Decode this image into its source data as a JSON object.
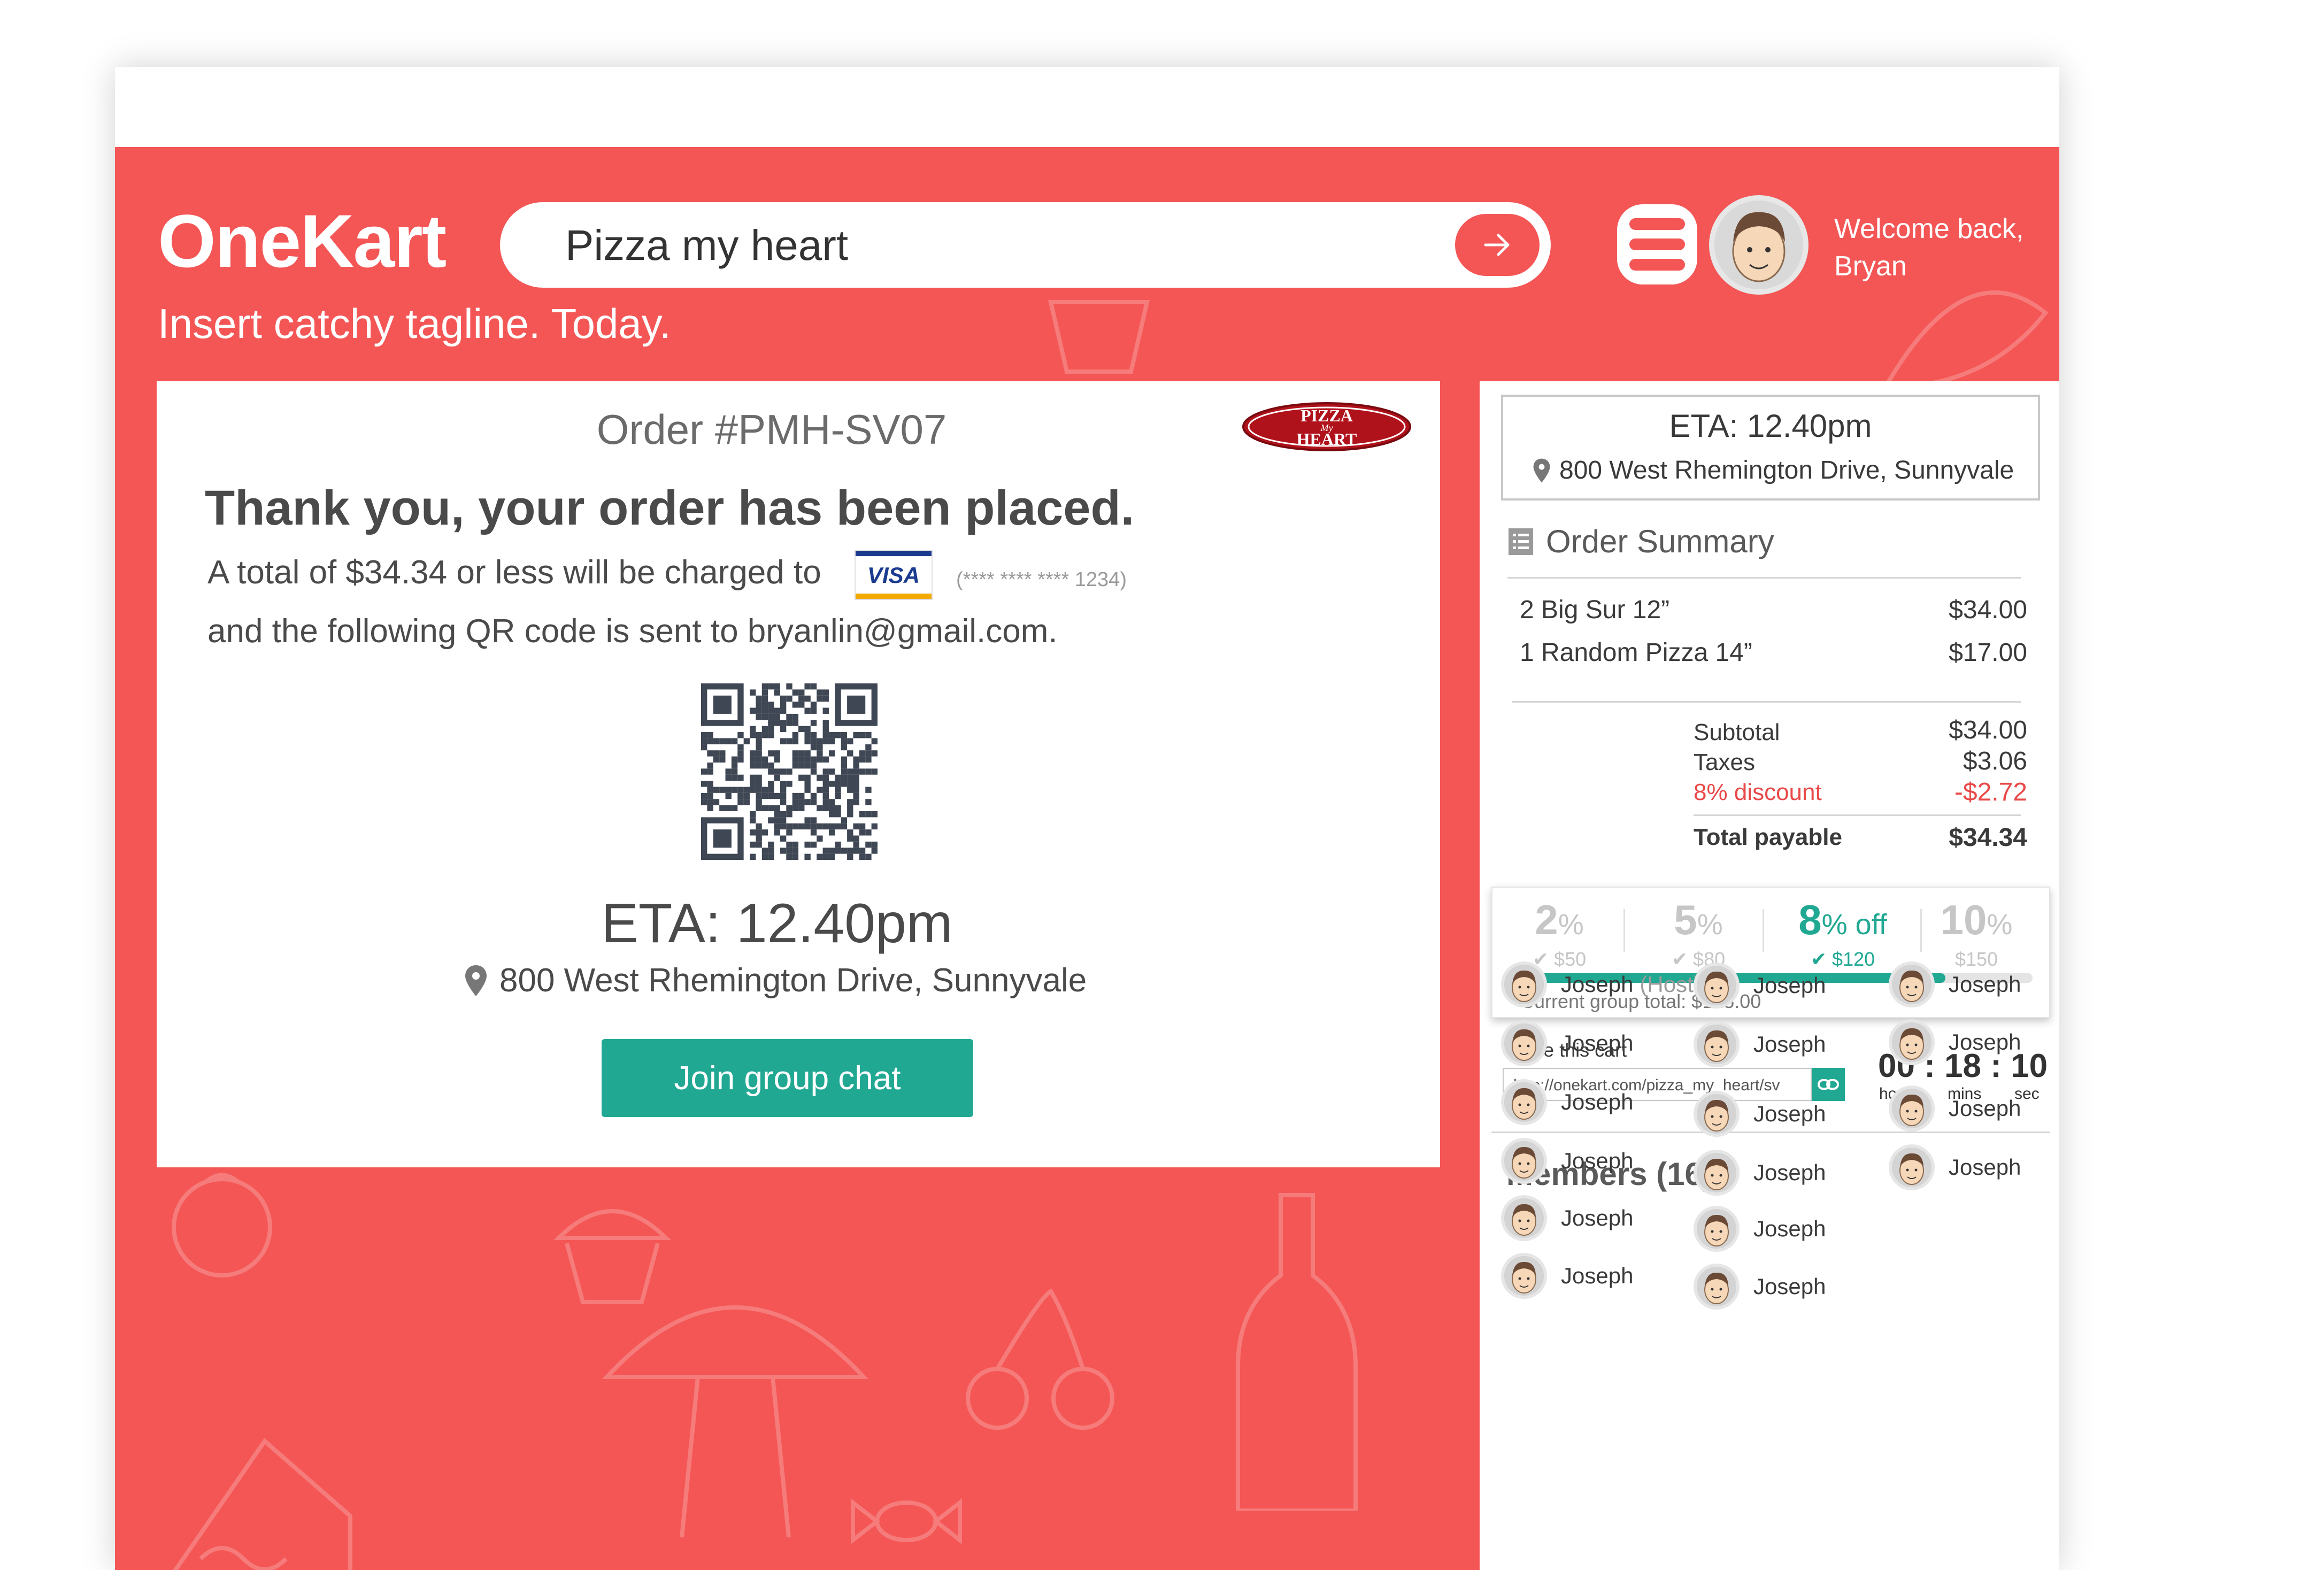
{
  "header": {
    "brand": "OneKart",
    "tagline": "Insert catchy tagline. Today.",
    "search_value": "Pizza my heart",
    "welcome_line1": "Welcome back,",
    "welcome_line2": "Bryan"
  },
  "order": {
    "number": "Order #PMH-SV07",
    "restaurant_logo_line1": "PIZZA",
    "restaurant_logo_line2": "My",
    "restaurant_logo_line3": "HEART",
    "thank_you": "Thank you, your order has been placed.",
    "charged_text": "A total of $34.34 or less will be charged to",
    "card_brand": "VISA",
    "card_mask": "(**** **** **** 1234)",
    "qr_text": "and the following QR code is sent to bryanlin@gmail.com.",
    "eta": "ETA: 12.40pm",
    "address": "800 West Rhemington Drive, Sunnyvale",
    "join_button": "Join group chat"
  },
  "summary": {
    "eta": "ETA: 12.40pm",
    "address": "800 West Rhemington Drive, Sunnyvale",
    "title": "Order Summary",
    "items": [
      {
        "name": "2 Big Sur 12”",
        "price": "$34.00"
      },
      {
        "name": "1 Random Pizza 14”",
        "price": "$17.00"
      }
    ],
    "subtotal_label": "Subtotal",
    "subtotal": "$34.00",
    "taxes_label": "Taxes",
    "taxes": "$3.06",
    "discount_label": "8% discount",
    "discount": "-$2.72",
    "total_label": "Total payable",
    "total": "$34.34"
  },
  "tiers": {
    "items": [
      {
        "pct": "2",
        "unit": "%",
        "amount": "$50"
      },
      {
        "pct": "5",
        "unit": "%",
        "amount": "$80"
      },
      {
        "pct": "8",
        "unit": "% off",
        "amount": "$120"
      },
      {
        "pct": "10",
        "unit": "%",
        "amount": "$150"
      }
    ],
    "progress_fraction": 0.83,
    "group_total": "Current group total: $125.00"
  },
  "share": {
    "label": "Share this cart",
    "url": "http://onekart.com/pizza_my_heart/sv",
    "timer": "00 : 18 : 10",
    "hours": "hours",
    "mins": "mins",
    "sec": "sec"
  },
  "members": {
    "title": "Members (16)",
    "host_tag": "(Host)",
    "list": [
      "Joseph",
      "Joseph",
      "Joseph",
      "Joseph",
      "Joseph",
      "Joseph",
      "Joseph",
      "Joseph",
      "Joseph",
      "Joseph",
      "Joseph",
      "Joseph",
      "Joseph",
      "Joseph",
      "Joseph",
      "Joseph"
    ]
  },
  "colors": {
    "brand_red": "#f45656",
    "accent_teal": "#21a893",
    "discount_red": "#e84848"
  },
  "icons": [
    "arrow-right-icon",
    "menu-icon",
    "location-pin-icon",
    "list-icon",
    "check-circle-icon",
    "link-icon",
    "avatar-icon"
  ]
}
